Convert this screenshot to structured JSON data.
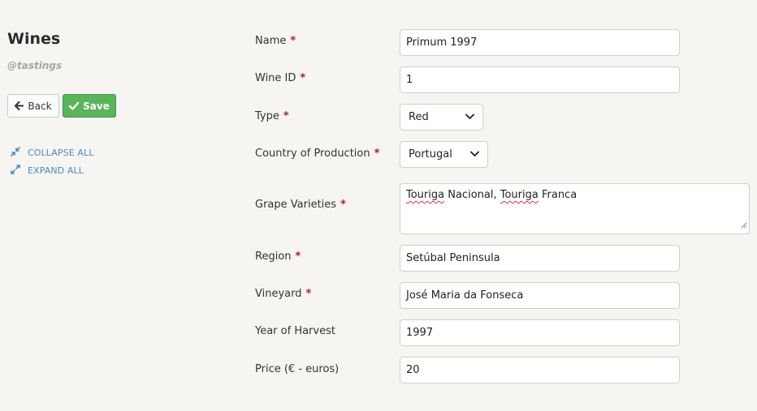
{
  "sidebar": {
    "title": "Wines",
    "subtitle": "@tastings",
    "back_label": "Back",
    "save_label": "Save",
    "collapse_label": "COLLAPSE ALL",
    "expand_label": "EXPAND ALL"
  },
  "form": {
    "name": {
      "label": "Name",
      "required": "*",
      "value": "Primum 1997"
    },
    "wine_id": {
      "label": "Wine ID",
      "required": "*",
      "value": "1"
    },
    "type": {
      "label": "Type",
      "required": "*",
      "selected": "Red"
    },
    "country": {
      "label": "Country of Production",
      "required": "*",
      "selected": "Portugal"
    },
    "grapes": {
      "label": "Grape Varieties",
      "required": "*",
      "part1": "Touriga",
      "part2": " Nacional, ",
      "part3": "Touriga",
      "part4": " Franca"
    },
    "region": {
      "label": "Region",
      "required": "*",
      "value": "Setúbal Peninsula"
    },
    "vineyard": {
      "label": "Vineyard",
      "required": "*",
      "value": "José Maria da Fonseca"
    },
    "year": {
      "label": "Year of Harvest",
      "value": "1997"
    },
    "price": {
      "label": "Price (€ - euros)",
      "value": "20"
    }
  },
  "icons": {
    "back": "arrow-left-icon",
    "save": "check-icon",
    "collapse": "compress-icon",
    "expand": "expand-icon",
    "dropdown": "chevron-down-icon"
  },
  "colors": {
    "background": "#f6f5f2",
    "save_button": "#58b55a",
    "required_marker": "#b01b34",
    "link": "#4a8ac0"
  }
}
